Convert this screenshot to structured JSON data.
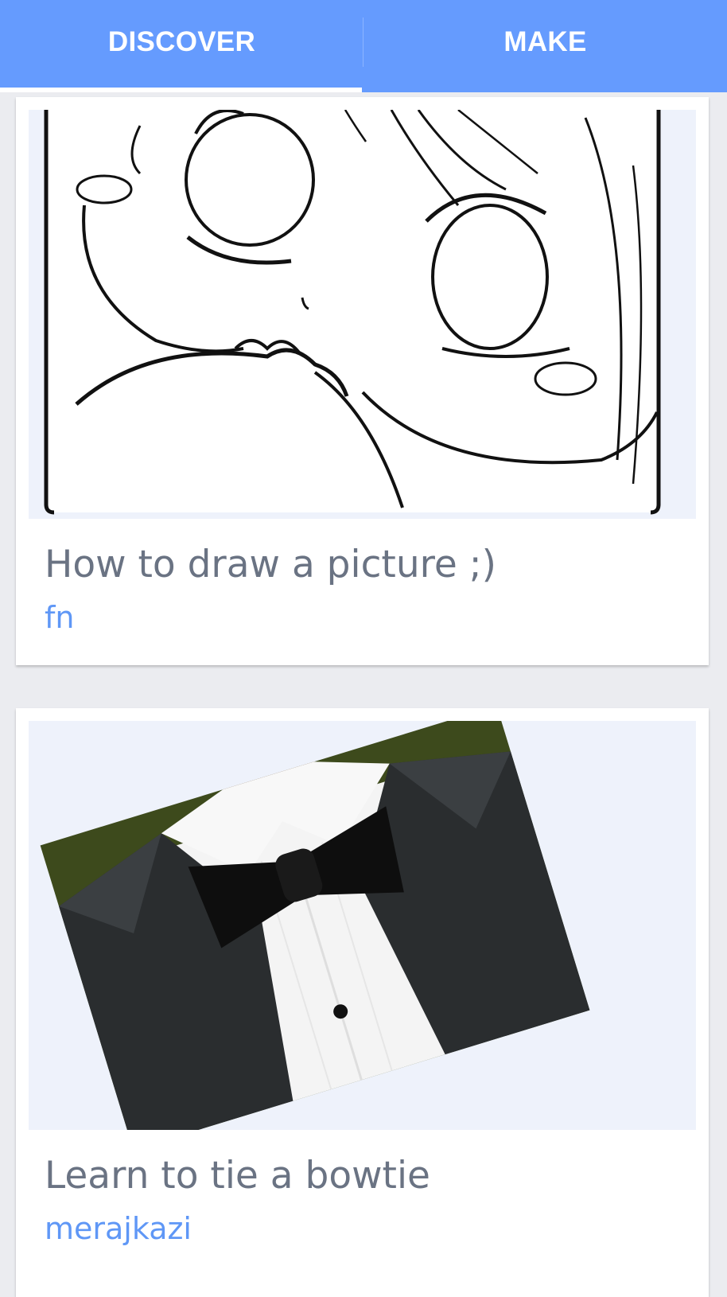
{
  "tabs": {
    "discover": "DISCOVER",
    "make": "MAKE",
    "active": "discover"
  },
  "colors": {
    "tab_bar": "#659bfe",
    "background": "#ebecf0",
    "title_text": "#6a7383",
    "author_text": "#5f97f6",
    "thumbnail_bg": "#eef2fb"
  },
  "projects": [
    {
      "title": "How to draw a picture ;)",
      "author": "fn",
      "thumbnail": "cartoon-face-drawing"
    },
    {
      "title": "Learn to tie a bowtie",
      "author": "merajkazi",
      "thumbnail": "tuxedo-bowtie-photo"
    }
  ]
}
